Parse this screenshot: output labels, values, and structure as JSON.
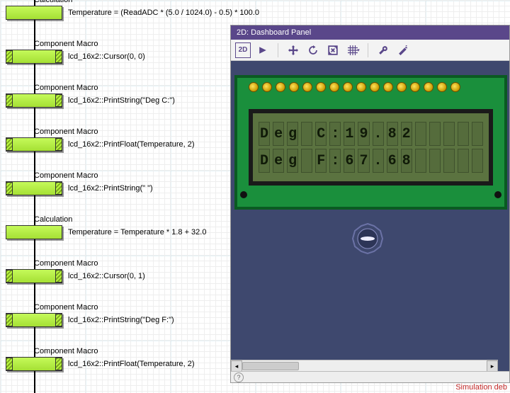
{
  "blocks": [
    {
      "type": "calc",
      "label": "Calculation",
      "desc": "Temperature = (ReadADC * (5.0 / 1024.0) - 0.5) * 100.0"
    },
    {
      "type": "macro",
      "label": "Component Macro",
      "desc": "lcd_16x2::Cursor(0, 0)"
    },
    {
      "type": "macro",
      "label": "Component Macro",
      "desc": "lcd_16x2::PrintString(\"Deg C:\")"
    },
    {
      "type": "macro",
      "label": "Component Macro",
      "desc": "lcd_16x2::PrintFloat(Temperature, 2)"
    },
    {
      "type": "macro",
      "label": "Component Macro",
      "desc": "lcd_16x2::PrintString(\" \")"
    },
    {
      "type": "calc",
      "label": "Calculation",
      "desc": "Temperature = Temperature * 1.8 + 32.0"
    },
    {
      "type": "macro",
      "label": "Component Macro",
      "desc": "lcd_16x2::Cursor(0, 1)"
    },
    {
      "type": "macro",
      "label": "Component Macro",
      "desc": "lcd_16x2::PrintString(\"Deg F:\")"
    },
    {
      "type": "macro",
      "label": "Component Macro",
      "desc": "lcd_16x2::PrintFloat(Temperature, 2)"
    }
  ],
  "dashboard": {
    "title": "2D: Dashboard Panel",
    "tools": {
      "mode2d": "2D",
      "play": "play-icon",
      "pan": "pan-icon",
      "rotate": "rotate-icon",
      "fit": "fit-icon",
      "grid": "grid-icon",
      "wrench": "wrench-icon",
      "wand": "wand-icon"
    },
    "lcd": {
      "row1": [
        "D",
        "e",
        "g",
        " ",
        "C",
        ":",
        "1",
        "9",
        ".",
        "8",
        "2",
        " ",
        " ",
        " ",
        " ",
        " "
      ],
      "row2": [
        "D",
        "e",
        "g",
        " ",
        "F",
        ":",
        "6",
        "7",
        ".",
        "6",
        "8",
        " ",
        " ",
        " ",
        " ",
        " "
      ]
    },
    "pin_count": 16,
    "help_icon": "?"
  },
  "status": "Simulation deb",
  "colors": {
    "accent": "#5a478a",
    "pcb": "#1a8f3c",
    "lcd": "#5b7340",
    "block": "#b9f73e"
  }
}
